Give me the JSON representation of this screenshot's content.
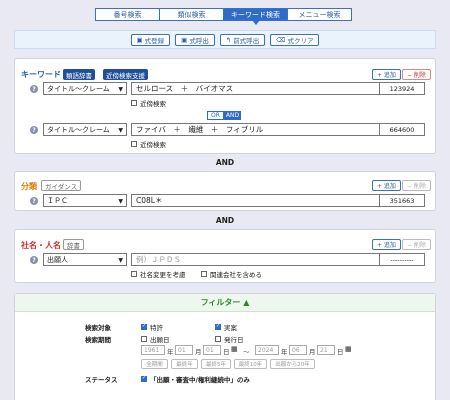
{
  "tabs": [
    "番号検索",
    "類似検索",
    "キーワード検索",
    "メニュー検索"
  ],
  "toolbar": [
    "式登録",
    "式呼出",
    "前式呼出",
    "式クリア"
  ],
  "keyword": {
    "label": "キーワード",
    "badge1": "類語辞書",
    "badge2": "近傍検索支援",
    "add": "+ 追加",
    "del": "− 削除",
    "rows": [
      {
        "field": "タイトル〜クレーム",
        "text": "セルロース　＋　バイオマス",
        "count": "123924",
        "near": "近傍検索"
      },
      {
        "field": "タイトル〜クレーム",
        "text": "ファイバ　＋　繊維　＋　フィブリル",
        "count": "664600",
        "near": "近傍検索"
      }
    ],
    "or": "OR",
    "and": "AND"
  },
  "and_text": "AND",
  "bunrui": {
    "label": "分類",
    "guide": "ガイダンス",
    "add": "+ 追加",
    "del": "− 削除",
    "field": "ＩＰＣ",
    "text": "C08L＊",
    "count": "351663"
  },
  "company": {
    "label": "社名・人名",
    "dict": "辞書",
    "add": "+ 追加",
    "del": "− 削除",
    "field": "出願人",
    "placeholder": "例）ＪＰＤＳ",
    "count": "----------",
    "opt1": "社名変更を考慮",
    "opt2": "関連会社を含める"
  },
  "filter": {
    "title": "フィルター",
    "target_label": "検索対象",
    "target_opts": [
      "特許",
      "実案"
    ],
    "period_label": "検索期間",
    "period_opts": [
      "出願日",
      "発行日"
    ],
    "from_year": "1961",
    "from_month": "01",
    "from_day": "01",
    "to_year": "2024",
    "to_month": "06",
    "to_day": "21",
    "u_year": "年",
    "u_month": "月",
    "u_day": "日",
    "tilde": "〜",
    "range_buttons": [
      "全期間",
      "最終年",
      "最終5年",
      "最終10年",
      "出願から20年"
    ],
    "status_label": "ステータス",
    "status_text": "「出願・審査中/権利継続中」のみ"
  }
}
